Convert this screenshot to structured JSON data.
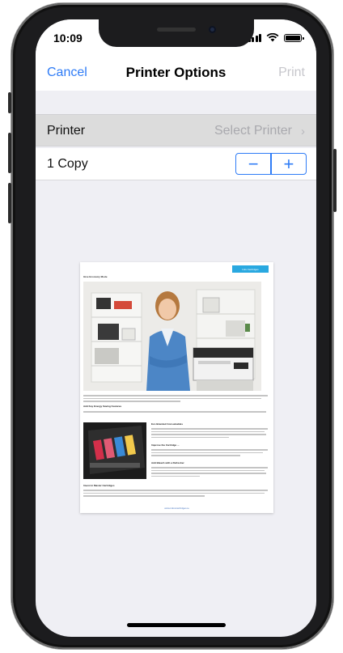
{
  "status_bar": {
    "time": "10:09",
    "icons": [
      "cellular-signal-icon",
      "wifi-icon",
      "battery-icon"
    ]
  },
  "nav": {
    "cancel_label": "Cancel",
    "title": "Printer Options",
    "print_label": "Print"
  },
  "printer_row": {
    "label": "Printer",
    "value": "Select Printer",
    "icon": "chevron-right-icon"
  },
  "copies_row": {
    "label": "1 Copy",
    "decrement_glyph": "−",
    "increment_glyph": "+"
  },
  "preview": {
    "doc_title": "Give Economy Mode",
    "logo_text": "Inks Cartridges",
    "headings": [
      "Eco Branded Consumables",
      "Improve the Cartridge ...",
      "Add Key Energy Saving Features",
      "Add Bleach with a Refresher",
      "Invest in Master Cartridges"
    ],
    "footer_link": "www.inksncartridges.ie"
  },
  "colors": {
    "accent": "#2f7cf6",
    "disabled": "#c7c7cc",
    "background": "#efeff4",
    "selected_row": "#dcdcdc"
  }
}
